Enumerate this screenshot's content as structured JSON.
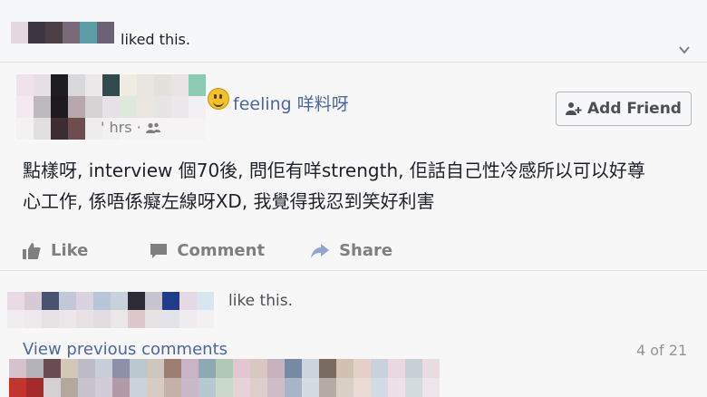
{
  "story": {
    "liked_suffix": "liked this."
  },
  "post": {
    "feeling_label": "feeling 咩料呀",
    "time": "' hrs ·",
    "add_friend_label": "Add Friend",
    "text_line1": "點樣呀, interview 個70後, 問佢有咩strength, 佢話自己性冷感所以可以好尊",
    "text_line2": "心工作, 係唔係癡左線呀XD, 我覺得我忍到笑好利害",
    "icons": {
      "feeling": "smiley-emoji-icon",
      "audience": "friends-icon",
      "add_friend": "add-friend-icon",
      "expand": "chevron-down-icon"
    }
  },
  "actions": {
    "like": "Like",
    "comment": "Comment",
    "share": "Share"
  },
  "reactions": {
    "like_suffix": "like this."
  },
  "comments": {
    "view_previous": "View previous comments",
    "counter": "4 of 21"
  },
  "colors": {
    "link_blue": "#4b67a1",
    "muted_gray": "#7f7f7f",
    "background": "#f6f7f9"
  }
}
